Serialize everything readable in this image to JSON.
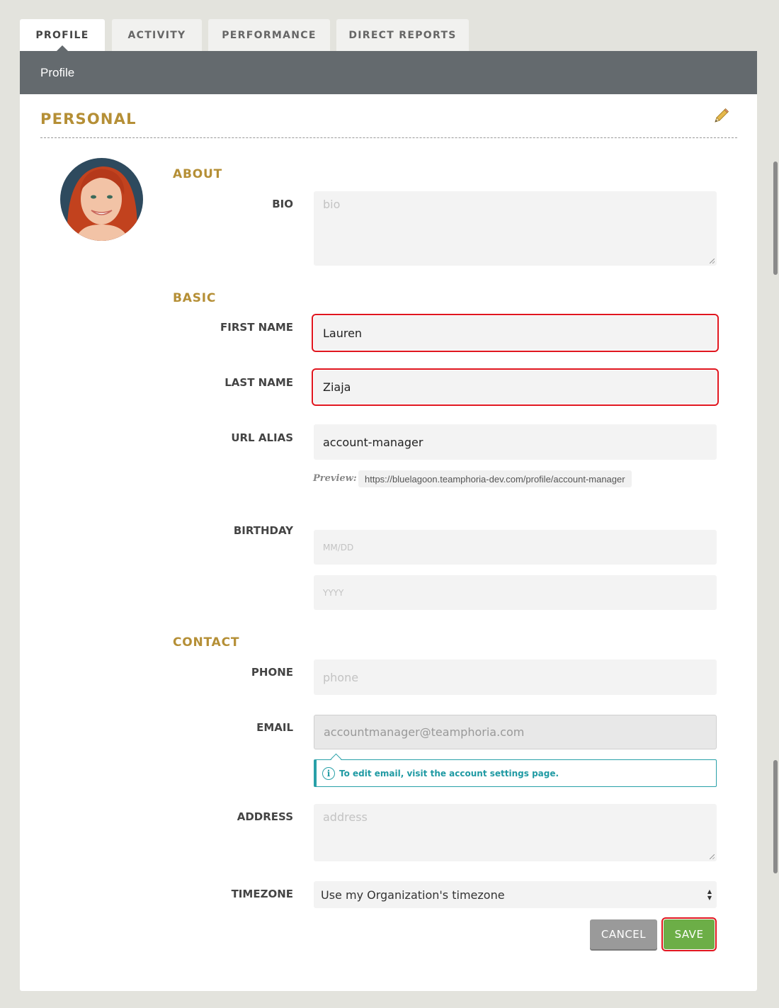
{
  "tabs": [
    {
      "label": "PROFILE",
      "active": true
    },
    {
      "label": "ACTIVITY"
    },
    {
      "label": "PERFORMANCE"
    },
    {
      "label": "DIRECT REPORTS"
    }
  ],
  "subheader": {
    "title": "Profile"
  },
  "section": {
    "title": "PERSONAL"
  },
  "groups": {
    "about": "ABOUT",
    "basic": "BASIC",
    "contact": "CONTACT"
  },
  "fields": {
    "bio": {
      "label": "BIO",
      "placeholder": "bio"
    },
    "first_name": {
      "label": "FIRST NAME",
      "value": "Lauren"
    },
    "last_name": {
      "label": "LAST NAME",
      "value": "Ziaja"
    },
    "url_alias": {
      "label": "URL ALIAS",
      "value": "account-manager"
    },
    "preview": {
      "label": "Preview:",
      "url": "https://bluelagoon.teamphoria-dev.com/profile/account-manager"
    },
    "birthday": {
      "label": "BIRTHDAY",
      "placeholder_md": "MM/DD",
      "placeholder_year": "YYYY"
    },
    "phone": {
      "label": "PHONE",
      "placeholder": "phone"
    },
    "email": {
      "label": "EMAIL",
      "value": "accountmanager@teamphoria.com",
      "info": "To edit email, visit the account settings page."
    },
    "address": {
      "label": "ADDRESS",
      "placeholder": "address"
    },
    "timezone": {
      "label": "TIMEZONE",
      "selected": "Use my Organization's timezone"
    }
  },
  "buttons": {
    "cancel": "CANCEL",
    "save": "SAVE"
  },
  "colors": {
    "accent": "#b58f36",
    "header": "#646a6e",
    "save": "#6cae47",
    "error": "#e0161f",
    "info": "#28a0a8"
  }
}
